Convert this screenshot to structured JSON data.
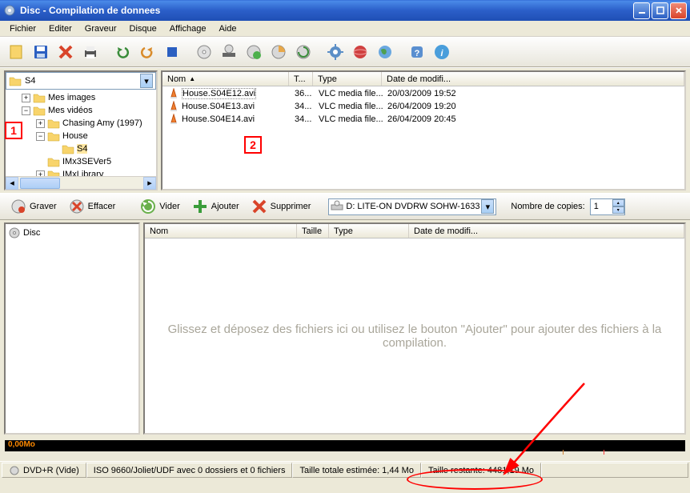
{
  "title": "Disc - Compilation de donnees",
  "menubar": [
    "Fichier",
    "Editer",
    "Graveur",
    "Disque",
    "Affichage",
    "Aide"
  ],
  "tree": {
    "selected": "S4",
    "nodes": [
      {
        "label": "Mes images",
        "indent": 1,
        "expander": "+"
      },
      {
        "label": "Mes vidéos",
        "indent": 1,
        "expander": "-"
      },
      {
        "label": "Chasing Amy (1997)",
        "indent": 2,
        "expander": "+"
      },
      {
        "label": "House",
        "indent": 2,
        "expander": "-"
      },
      {
        "label": "S4",
        "indent": 3,
        "selected": true
      },
      {
        "label": "IMx3SEVer5",
        "indent": 2
      },
      {
        "label": "IMxLibrary",
        "indent": 2,
        "expander": "+"
      }
    ]
  },
  "file_columns": {
    "name": "Nom",
    "size": "T...",
    "type": "Type",
    "date": "Date de modifi..."
  },
  "files": [
    {
      "name": "House.S04E12.avi",
      "size": "36...",
      "type": "VLC media file...",
      "date": "20/03/2009 19:52",
      "selected": true
    },
    {
      "name": "House.S04E13.avi",
      "size": "34...",
      "type": "VLC media file...",
      "date": "26/04/2009 19:20"
    },
    {
      "name": "House.S04E14.avi",
      "size": "34...",
      "type": "VLC media file...",
      "date": "26/04/2009 20:45"
    }
  ],
  "mid": {
    "burn": "Graver",
    "erase": "Effacer",
    "empty": "Vider",
    "add": "Ajouter",
    "remove": "Supprimer",
    "drive_icon": "💿",
    "drive": "D: LITE-ON DVDRW SOHW-1633",
    "copies_label": "Nombre de copies:",
    "copies": "1"
  },
  "disc_root": "Disc",
  "comp_columns": {
    "name": "Nom",
    "size": "Taille",
    "type": "Type",
    "date": "Date de modifi..."
  },
  "drop_hint": "Glissez et déposez des fichiers ici ou utilisez le bouton \"Ajouter\" pour ajouter des fichiers à la compilation.",
  "capacity_label": "0,00Mo",
  "status": {
    "disc": "DVD+R (Vide)",
    "fs": "ISO 9660/Joliet/UDF avec 0 dossiers et 0 fichiers",
    "total": "Taille totale estimée: 1,44 Mo",
    "remaining": "Taille restante: 4481,19 Mo"
  },
  "markers": {
    "one": "1",
    "two": "2"
  }
}
